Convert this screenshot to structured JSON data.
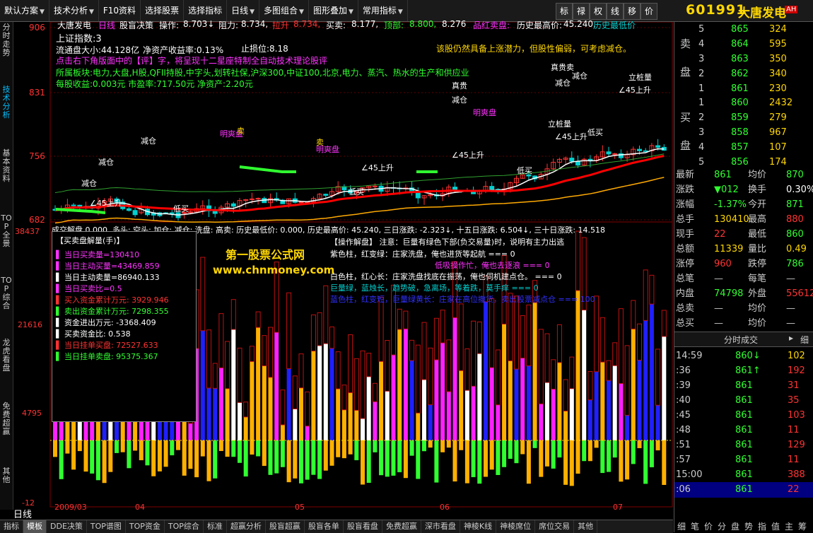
{
  "colors": {
    "up": "#ff3232",
    "down": "#00d0d0",
    "yellow": "#ffd700",
    "magenta": "#ff32ff",
    "white": "#ffffff",
    "blue": "#3030ff",
    "green": "#30ff30",
    "gray": "#c0c0c0"
  },
  "menu": [
    {
      "label": "默认方案",
      "dropdown": true
    },
    {
      "label": "技术分析",
      "dropdown": true
    },
    {
      "label": "F10资料",
      "dropdown": false
    },
    {
      "label": "选择股票",
      "dropdown": false
    },
    {
      "label": "选择指标",
      "dropdown": false
    },
    {
      "label": "日线",
      "dropdown": true
    },
    {
      "label": "多图组合",
      "dropdown": true
    },
    {
      "label": "图形叠加",
      "dropdown": true
    },
    {
      "label": "常用指标",
      "dropdown": true
    }
  ],
  "toolbar_buttons": [
    "标",
    "禄",
    "权",
    "线",
    "移",
    "价"
  ],
  "stock": {
    "code": "601991",
    "name": "大唐发电",
    "badge": "AH"
  },
  "left_tabs": [
    "分时走势",
    "技术分析",
    "基本资料",
    "TOP全景",
    "TOP综合",
    "龙虎看盘",
    "免费超赢",
    "其他"
  ],
  "chart": {
    "header_name": "大唐发电",
    "header_period": "日线",
    "header_indicator": "股盲决策",
    "op_label": "操作:",
    "op_value": "8.703↓",
    "resist_label": "阻力:",
    "resist_value": "8.734,",
    "lashi": "拉升",
    "lashi_value": "8.734,",
    "buy_label": "买卖:",
    "buy_value": "8.177,",
    "top_label": "顶部:",
    "top_value": "8.800,",
    "dpt_value": "8.276",
    "red_buy": "品红卖盘:",
    "hist_high_label": "历史最高价:",
    "hist_high_value": "45.240,",
    "hist_high_tail": "历史最低价",
    "index_line": "上证指数:3",
    "float_line": "流通盘大小:44.128亿",
    "cost_line": "净资产收益率:0.13%",
    "stop_line": "止损位:8.18",
    "hint_line": "点击右下角版面中的【评】字，将呈现十二星座特制全自动技术理论股评",
    "sector_line": "所属板块:电力,大盘,H股,QFII持股,中字头,划转社保,沪深300,中证100,北京,电力、蒸汽、热水的生产和供应业",
    "eps_line": "每股收益:0.003元 市盈率:717.50元 净资产:2.20元",
    "comment_line": "该股仍然具备上涨潜力，但股性偏弱，可考虑减仓。",
    "price_ticks": [
      "906",
      "831",
      "756",
      "682"
    ],
    "vol_ticks": [
      "38437",
      "21616",
      "4795",
      "-12"
    ],
    "date_labels": [
      "2009/03",
      "04",
      "05",
      "06",
      "07"
    ],
    "vol_header": "成交解盘 0.000, 多头: 空头: 加仓: 减仓: 洗盘: 高卖: 历史最低价: 0.000, 历史最高价: 45.240, 三日涨跌: -2.323↓, 十五日涨跌: 6.504↓, 三十日涨跌: 14.518",
    "watermark_1": "第一股票公式网",
    "watermark_2": "www.chnmoney.com",
    "op_box_title": "【操作解盘】 注意：巨量有绿色下部(负交易量)时，说明有主力出逃",
    "op_box_lines": [
      {
        "text": "紫色柱，红变绿：庄家洗盘，俺也进货等起航 === 0",
        "color": "#ffffff"
      },
      {
        "text": "低吸操作忙，俺也去逐浪 === 0",
        "color": "#ff32ff"
      },
      {
        "text": "白色柱，红心长：庄家洗盘找底在振荡，俺也伺机建点仓。 === 0",
        "color": "#ffffff"
      },
      {
        "text": "巨量绿，蓝烛长，趋势破，急离场，等着跌，莫手痒 === 0",
        "color": "#00d0d0"
      },
      {
        "text": "蓝色柱，红变短，巨量绿黄长：庄家在高位撤货，卖出股票减点仓 === 100",
        "color": "#3030ff"
      }
    ],
    "annotations": [
      "减仓",
      "减仓",
      "减仓",
      "明爽盘",
      "卖",
      "卖",
      "明爽盘",
      "真贵",
      "减仓",
      "明爽盘",
      "真贵卖",
      "减仓",
      "减仓",
      "立桩量",
      "立桩量",
      "低买",
      "低买",
      "低买",
      "低买",
      "∠45上升",
      "∠45上升",
      "∠45上升",
      "∠45上升",
      "∠45上升"
    ],
    "main_label": "日线"
  },
  "infobox": {
    "title": "【买卖盘解量(手)】",
    "rows": [
      {
        "text": "当日买卖量=130410",
        "color": "#ff32ff"
      },
      {
        "text": "当日主动买量=43469.859",
        "color": "#ff32ff"
      },
      {
        "text": "当日主动卖量=86940.133",
        "color": "#ffffff"
      },
      {
        "text": "当日买卖比=0.5",
        "color": "#ff32ff"
      },
      {
        "text": "买入资金累计万元: 3929.946",
        "color": "#ff3232"
      },
      {
        "text": "卖出资金累计万元: 7298.355",
        "color": "#30ff30"
      },
      {
        "text": "资金进出万元: -3368.409",
        "color": "#ffffff"
      },
      {
        "text": "买卖资金比: 0.538",
        "color": "#ffffff"
      },
      {
        "text": "当日挂单买盘: 72527.633",
        "color": "#ff3232"
      },
      {
        "text": "当日挂单卖盘: 95375.367",
        "color": "#30ff30"
      }
    ]
  },
  "quote": {
    "sell_label": [
      "卖",
      "盘"
    ],
    "buy_label": [
      "买",
      "盘"
    ],
    "sell": [
      {
        "lvl": "5",
        "price": "865",
        "vol": "324"
      },
      {
        "lvl": "4",
        "price": "864",
        "vol": "595"
      },
      {
        "lvl": "3",
        "price": "863",
        "vol": "350"
      },
      {
        "lvl": "2",
        "price": "862",
        "vol": "340"
      },
      {
        "lvl": "1",
        "price": "861",
        "vol": "230"
      }
    ],
    "buy": [
      {
        "lvl": "1",
        "price": "860",
        "vol": "2432"
      },
      {
        "lvl": "2",
        "price": "859",
        "vol": "279"
      },
      {
        "lvl": "3",
        "price": "858",
        "vol": "967"
      },
      {
        "lvl": "4",
        "price": "857",
        "vol": "107"
      },
      {
        "lvl": "5",
        "price": "856",
        "vol": "174"
      }
    ],
    "stats": [
      {
        "l1": "最新",
        "v1": "861",
        "c1": "#30ff30",
        "l2": "均价",
        "v2": "870",
        "c2": "#30ff30"
      },
      {
        "l1": "涨跌",
        "v1": "▼012",
        "c1": "#30ff30",
        "l2": "换手",
        "v2": "0.30%",
        "c2": "#ffffff"
      },
      {
        "l1": "涨幅",
        "v1": "-1.37%",
        "c1": "#30ff30",
        "l2": "今开",
        "v2": "871",
        "c2": "#30ff30"
      },
      {
        "l1": "总手",
        "v1": "130410",
        "c1": "#ffd700",
        "l2": "最高",
        "v2": "880",
        "c2": "#ff3232"
      },
      {
        "l1": "现手",
        "v1": "22",
        "c1": "#ff3232",
        "l2": "最低",
        "v2": "860",
        "c2": "#30ff30"
      },
      {
        "l1": "总额",
        "v1": "11339",
        "c1": "#ffd700",
        "l2": "量比",
        "v2": "0.49",
        "c2": "#ffd700"
      },
      {
        "l1": "涨停",
        "v1": "960",
        "c1": "#ff3232",
        "l2": "跌停",
        "v2": "786",
        "c2": "#30ff30"
      },
      {
        "l1": "总笔",
        "v1": "—",
        "c1": "#c0c0c0",
        "l2": "每笔",
        "v2": "—",
        "c2": "#c0c0c0"
      },
      {
        "l1": "内盘",
        "v1": "74798",
        "c1": "#30ff30",
        "l2": "外盘",
        "v2": "55612",
        "c2": "#ff3232"
      },
      {
        "l1": "总卖",
        "v1": "—",
        "c1": "#c0c0c0",
        "l2": "均价",
        "v2": "—",
        "c2": "#c0c0c0"
      },
      {
        "l1": "总买",
        "v1": "—",
        "c1": "#c0c0c0",
        "l2": "均价",
        "v2": "—",
        "c2": "#c0c0c0"
      }
    ],
    "ticks_header": "分时成交",
    "ticks_btn": "细",
    "ticks": [
      {
        "time": "14:59",
        "price": "860",
        "arrow": "↓",
        "vol": "102",
        "vc": "#ffd700"
      },
      {
        "time": ":36",
        "price": "861",
        "arrow": "↑",
        "vol": "192",
        "vc": "#ff3232"
      },
      {
        "time": ":39",
        "price": "861",
        "arrow": "",
        "vol": "31",
        "vc": "#ff3232"
      },
      {
        "time": ":40",
        "price": "861",
        "arrow": "",
        "vol": "35",
        "vc": "#ff3232"
      },
      {
        "time": ":45",
        "price": "861",
        "arrow": "",
        "vol": "103",
        "vc": "#ff3232"
      },
      {
        "time": ":48",
        "price": "861",
        "arrow": "",
        "vol": "11",
        "vc": "#ff3232"
      },
      {
        "time": ":51",
        "price": "861",
        "arrow": "",
        "vol": "129",
        "vc": "#ff3232"
      },
      {
        "time": ":57",
        "price": "861",
        "arrow": "",
        "vol": "11",
        "vc": "#ff3232"
      },
      {
        "time": "15:00",
        "price": "861",
        "arrow": "",
        "vol": "388",
        "vc": "#ff3232"
      },
      {
        "time": ":06",
        "price": "861",
        "arrow": "",
        "vol": "22",
        "vc": "#ff3232"
      }
    ]
  },
  "bottom_tabs": [
    "指标",
    "模板",
    "DDE决策",
    "TOP谱图",
    "TOP资金",
    "TOP综合",
    "标准",
    "超赢分析",
    "股盲超赢",
    "股盲各单",
    "股盲看盘",
    "免费超赢",
    "深市看盘",
    "神棱K线",
    "神棱席位",
    "席位交易",
    "其他"
  ],
  "right_bottom_tabs": [
    "细",
    "笔",
    "价",
    "分",
    "盘",
    "势",
    "指",
    "值",
    "主",
    "筹"
  ]
}
